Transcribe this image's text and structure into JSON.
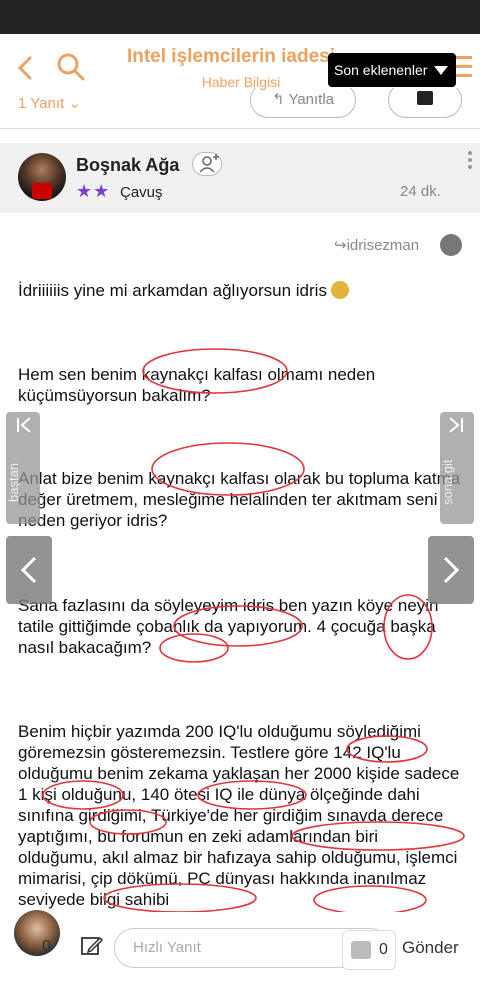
{
  "header": {
    "title": "Intel işlemcilerin iadesi",
    "subtitle": "Haber Bilgisi",
    "sort_label": "Son eklenenler"
  },
  "subheader": {
    "replies_label": "1 Yanıt",
    "reply_button": "Yanıtla"
  },
  "post": {
    "username": "Boşnak Ağa",
    "rank": "Çavuş",
    "stars": "★★",
    "time": "24 dk.",
    "quoted_user": "idrisezman",
    "paragraphs": [
      "İdriiiiiis yine mi arkamdan ağlıyorsun idris",
      "Hem sen benim kaynakçı kalfası olmamı neden küçümsüyorsun bakalım?",
      "Anlat bize benim kaynakçı kalfası olarak bu topluma katma değer üretmem, mesleğime helalinden ter akıtmam seni neden geriyor idris?",
      "Sana fazlasını da söyleyeyim idris ben yazın köye neyin tatile gittiğimde çobanlık da yapıyorum. 4 çocuğa başka nasıl bakacağım?",
      "Benim hiçbir yazımda 200 IQ'lu olduğumu söylediğimi göremezsin gösteremezsin. Testlere göre 142 IQ'lu olduğumu benim zekama yaklaşan her 2000 kişide sadece 1 kişi olduğunu, 140 ötesi IQ ile dünya ölçeğinde dahi sınıfına girdiğimi, Türkiye'de her girdiğim sınavda derece yaptığımı, bu forumun en zeki adamlarından biri olduğumu, akıl almaz bir hafızaya sahip olduğumu, işlemci mimarisi, çip dökümü, PC dünyası hakkında inanılmaz seviyede bilgi sahibi"
    ]
  },
  "side_nav": {
    "first_label": "baştan",
    "last_label": "sona git"
  },
  "bottom_bar": {
    "count": "0",
    "input_placeholder": "Hızlı Yanıt",
    "like_count": "0",
    "send_label": "Gönder"
  }
}
